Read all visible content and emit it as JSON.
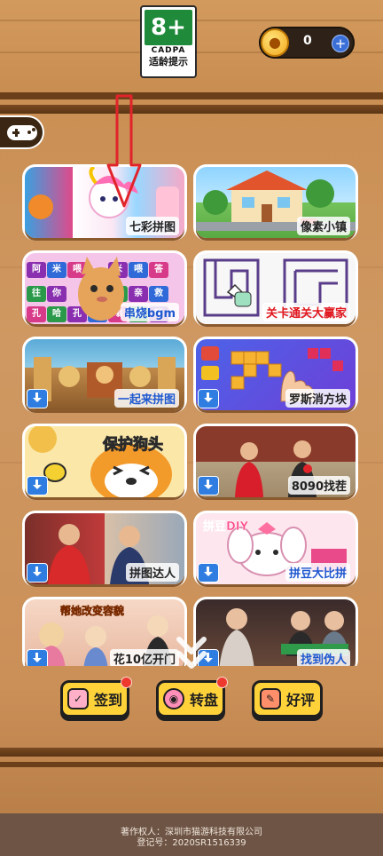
{
  "age_rating": {
    "number": "8+",
    "org": "CADPA",
    "label": "适龄提示"
  },
  "coins": {
    "value": "0",
    "coin_icon": "paw-coin-icon",
    "add_icon": "plus-icon"
  },
  "games": [
    {
      "label": "七彩拼图",
      "style": "dark",
      "download": false
    },
    {
      "label": "像素小镇",
      "style": "dark",
      "download": false
    },
    {
      "label": "串烧bgm",
      "style": "blue",
      "download": false
    },
    {
      "label": "关卡通关大赢家",
      "style": "red",
      "download": false
    },
    {
      "label": "一起来拼图",
      "style": "blue",
      "download": true
    },
    {
      "label": "罗斯消方块",
      "style": "dark",
      "download": true
    },
    {
      "label": "",
      "style": "dark",
      "download": true
    },
    {
      "label": "8090找茬",
      "style": "dark",
      "download": true
    },
    {
      "label": "拼图达人",
      "style": "dark",
      "download": true
    },
    {
      "label": "拼豆大比拼",
      "style": "blue",
      "download": true
    },
    {
      "label": "花10亿开门",
      "style": "dark",
      "download": true
    },
    {
      "label": "找到伪人",
      "style": "blue",
      "download": true
    }
  ],
  "art_text": {
    "dog_head": "保护狗头",
    "bead_diy": "拼豆DIY",
    "help_her": "帮她改变容貌",
    "word_grid": [
      "阿",
      "米",
      "喂",
      "",
      "米",
      "喂",
      "答",
      "往",
      "你",
      "",
      "你",
      "爽",
      "亲",
      "救",
      "孔",
      "哈",
      "孔",
      "哈",
      "嗡",
      "救",
      "咪",
      "基"
    ]
  },
  "bottom_buttons": [
    {
      "label": "签到",
      "icon": "calendar-check-icon",
      "badge": true
    },
    {
      "label": "转盘",
      "icon": "wheel-icon",
      "badge": true
    },
    {
      "label": "好评",
      "icon": "pencil-icon",
      "badge": false
    }
  ],
  "footer": {
    "line1": "著作权人：深圳市猫游科技有限公司",
    "line2": "登记号：2020SR1516339"
  },
  "colors": {
    "accent_yellow": "#ffd23a",
    "badge_red": "#ee3a2e",
    "download_blue": "#2f7de0",
    "rating_green": "#1e8a3a"
  }
}
